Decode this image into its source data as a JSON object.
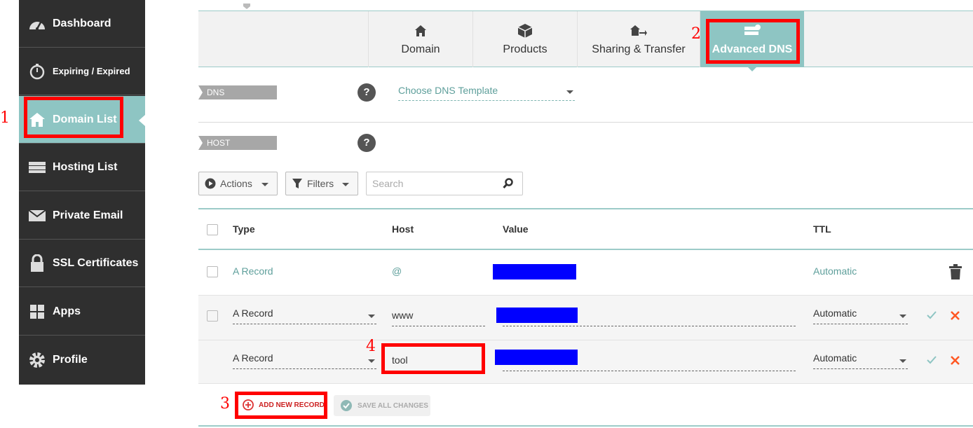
{
  "sidebar": {
    "items": [
      {
        "label": "Dashboard",
        "icon": "speedometer-icon"
      },
      {
        "label": "Expiring / Expired",
        "icon": "stopwatch-icon"
      },
      {
        "label": "Domain List",
        "icon": "home-icon",
        "active": true
      },
      {
        "label": "Hosting List",
        "icon": "server-icon"
      },
      {
        "label": "Private Email",
        "icon": "envelope-icon"
      },
      {
        "label": "SSL Certificates",
        "icon": "lock-icon"
      },
      {
        "label": "Apps",
        "icon": "apps-grid-icon"
      },
      {
        "label": "Profile",
        "icon": "gear-icon"
      }
    ]
  },
  "annotations": {
    "one": "1",
    "two": "2",
    "three": "3",
    "four": "4",
    "color": "#ff0000"
  },
  "tabs": [
    {
      "label": "Domain",
      "icon": "home-icon"
    },
    {
      "label": "Products",
      "icon": "box-icon"
    },
    {
      "label": "Sharing & Transfer",
      "icon": "transfer-icon"
    },
    {
      "label": "Advanced DNS",
      "icon": "dns-server-icon",
      "active": true
    }
  ],
  "dns_templates": {
    "label": "DNS TEMPLATES",
    "select_placeholder": "Choose DNS Template",
    "help": "?"
  },
  "host_records": {
    "label": "HOST RECORDS",
    "help": "?"
  },
  "toolbar": {
    "actions_label": "Actions",
    "filters_label": "Filters",
    "search_placeholder": "Search"
  },
  "table": {
    "headers": {
      "type": "Type",
      "host": "Host",
      "value": "Value",
      "ttl": "TTL"
    },
    "rows": [
      {
        "type": "A Record",
        "host": "@",
        "value": "",
        "ttl": "Automatic",
        "mode": "view"
      },
      {
        "type": "A Record",
        "host": "www",
        "value": "",
        "ttl": "Automatic",
        "mode": "edit"
      },
      {
        "type": "A Record",
        "host": "tool",
        "value": "",
        "ttl": "Automatic",
        "mode": "new"
      }
    ]
  },
  "footer": {
    "add_label": "ADD NEW RECORD",
    "save_label": "SAVE ALL CHANGES"
  },
  "colors": {
    "accent": "#8ec5c3",
    "sidebar": "#2f2f2f",
    "redacted": "#0000ff",
    "delete": "#ff5722"
  }
}
